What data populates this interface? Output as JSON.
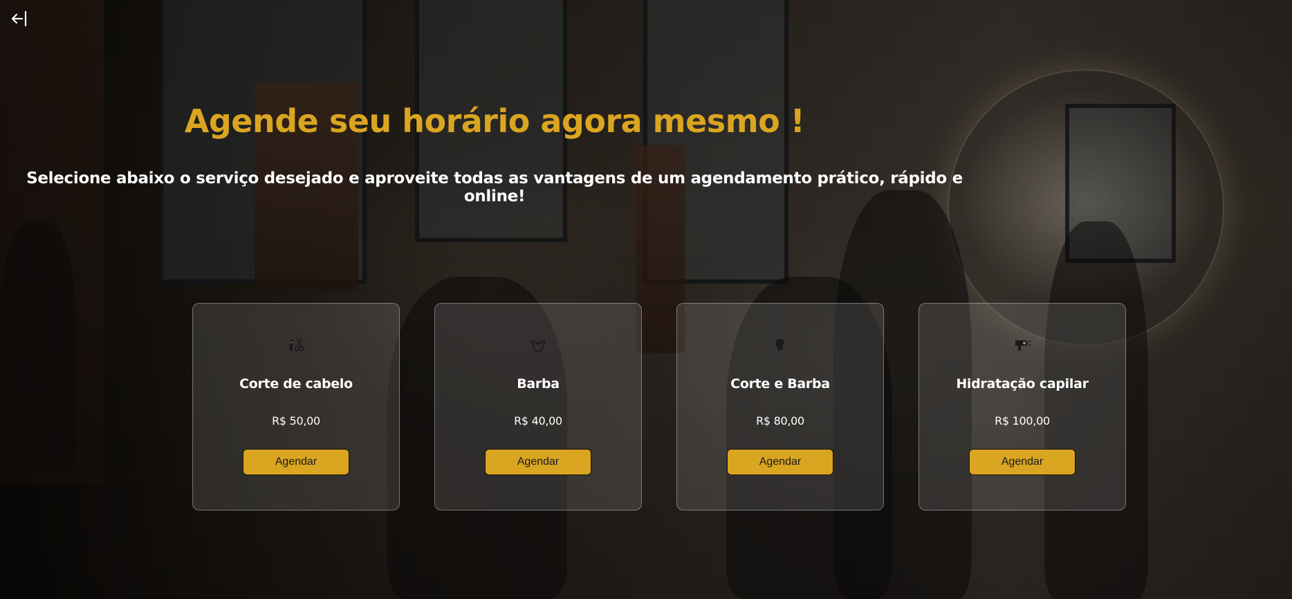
{
  "header": {
    "back_icon": "arrow-left-bar-icon",
    "title": "Agende seu horário agora mesmo !",
    "subtitle": "Selecione abaixo o serviço desejado e aproveite todas as vantagens de um agendamento prático, rápido e online!"
  },
  "colors": {
    "accent": "#daa520",
    "text": "#ffffff",
    "card_bg": "rgba(200,200,200,0.16)"
  },
  "services": [
    {
      "icon": "clipper-scissors-icon",
      "name": "Corte de cabelo",
      "price": "R$ 50,00",
      "button": "Agendar"
    },
    {
      "icon": "beard-icon",
      "name": "Barba",
      "price": "R$ 40,00",
      "button": "Agendar"
    },
    {
      "icon": "hair-beard-profile-icon",
      "name": "Corte e Barba",
      "price": "R$ 80,00",
      "button": "Agendar"
    },
    {
      "icon": "hair-dryer-icon",
      "name": "Hidratação capilar",
      "price": "R$ 100,00",
      "button": "Agendar"
    }
  ]
}
